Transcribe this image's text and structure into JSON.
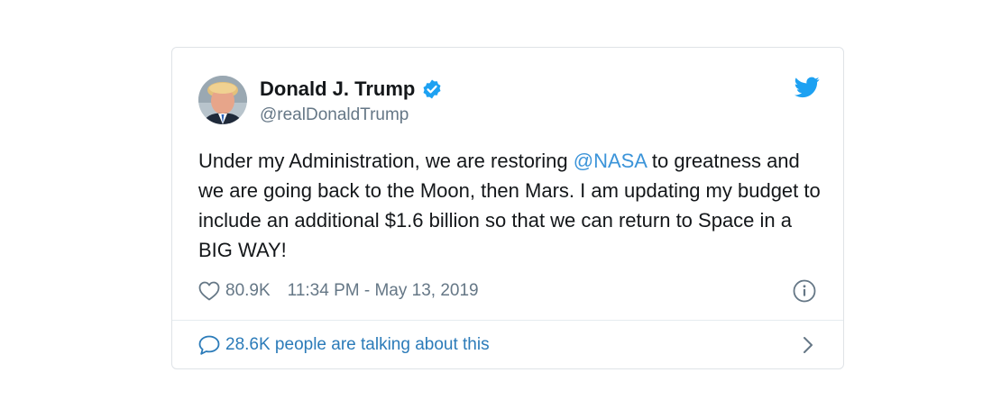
{
  "tweet": {
    "display_name": "Donald J. Trump",
    "handle": "@realDonaldTrump",
    "text_before_mention": "Under my Administration, we are restoring ",
    "mention": "@NASA",
    "text_after_mention": " to greatness and we are going back to the Moon, then Mars. I am updating my budget to include an additional $1.6 billion so that we can return to Space in a BIG WAY!",
    "likes": "80.9K",
    "timestamp": "11:34 PM - May 13, 2019"
  },
  "footer": {
    "conversation_label": "28.6K people are talking about this"
  },
  "icons": {
    "verified": "verified-badge-icon",
    "brand": "twitter-bird-icon",
    "like": "heart-icon",
    "info": "info-icon",
    "reply": "speech-bubble-icon",
    "chevron": "chevron-right-icon"
  },
  "colors": {
    "twitter_blue": "#1da1f2",
    "mention_blue": "#3b94d9",
    "link_blue": "#2b7bb9",
    "text": "#14171a",
    "muted": "#657786"
  }
}
